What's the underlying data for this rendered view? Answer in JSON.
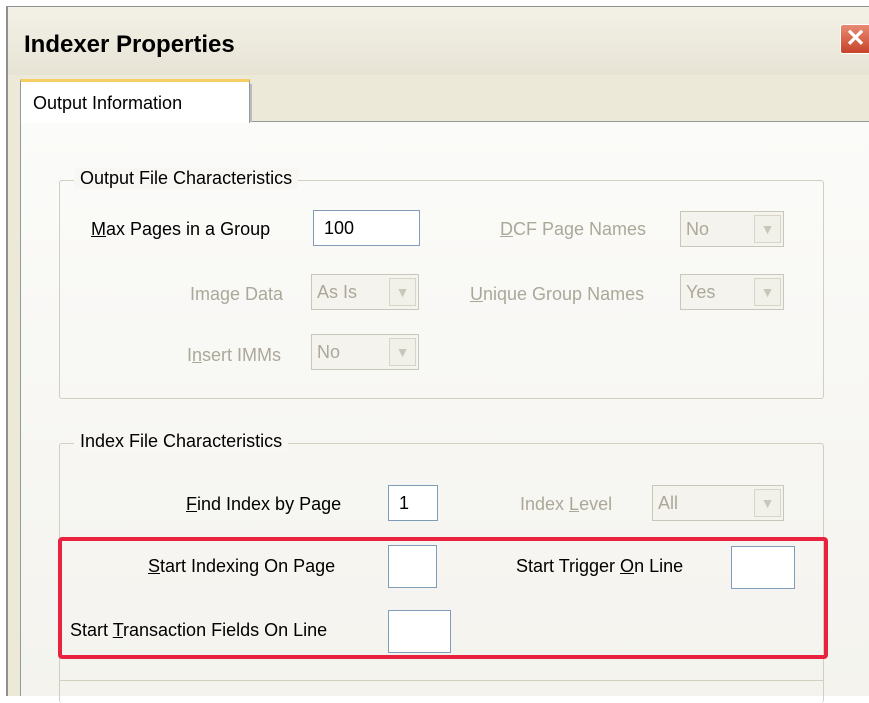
{
  "window": {
    "title": "Indexer Properties",
    "close_symbol": "✕"
  },
  "tabs": [
    {
      "label": "Output Information",
      "selected": true
    }
  ],
  "output_group": {
    "label": "Output File Characteristics",
    "max_pages": {
      "label_ul": "M",
      "label_rest": "ax Pages in a Group",
      "value": "100"
    },
    "dcf_page_names": {
      "label_ul": "D",
      "label_rest": "CF Page Names",
      "value": "No"
    },
    "image_data": {
      "label": "Image Data",
      "value": "As Is"
    },
    "unique_group_names": {
      "label_ul": "U",
      "label_rest": "nique Group Names",
      "value": "Yes"
    },
    "insert_imms": {
      "label_pre": "I",
      "label_ul": "n",
      "label_rest": "sert IMMs",
      "value": "No"
    }
  },
  "index_group": {
    "label": "Index File Characteristics",
    "find_index": {
      "label_ul": "F",
      "label_rest": "ind Index by Page",
      "value": "1"
    },
    "index_level": {
      "label_pre": "Index ",
      "label_ul": "L",
      "label_rest": "evel",
      "value": "All"
    },
    "start_indexing": {
      "label_ul": "S",
      "label_rest": "tart Indexing On Page",
      "value": ""
    },
    "start_trigger": {
      "label_pre": "Start Trigger ",
      "label_ul": "O",
      "label_rest": "n Line",
      "value": ""
    },
    "start_transaction": {
      "label_pre": "Start ",
      "label_ul": "T",
      "label_rest": "ransaction Fields On Line",
      "value": ""
    }
  },
  "colors": {
    "highlight": "#e8223f",
    "dialog_bg": "#ece9d8",
    "tab_accent": "#f7ce62"
  },
  "icons": {
    "close": "close-icon",
    "dropdown": "chevron-down-icon"
  }
}
